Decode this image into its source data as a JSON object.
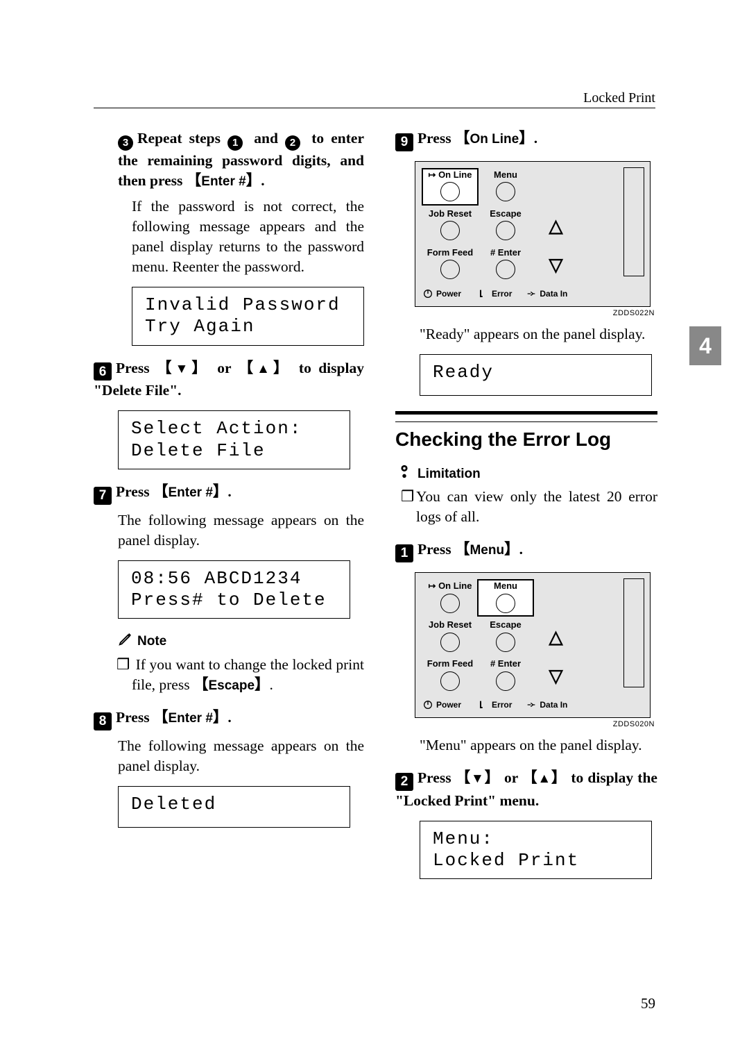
{
  "header": {
    "section": "Locked Print"
  },
  "sidetab": "4",
  "pagenum": "59",
  "left": {
    "sub3": {
      "text_a": "Repeat steps ",
      "text_b": " and ",
      "text_c": " to enter the remaining password digits, and then press ",
      "key": "Enter #",
      "body": "If the password is not correct, the following message appears and the panel display returns to the password menu. Reenter the password.",
      "lcd": "Invalid Password\nTry Again"
    },
    "step6": {
      "lead": "Press ",
      "or": " or ",
      "tail": " to display \"Delete File\".",
      "lcd": "Select Action:\nDelete File"
    },
    "step7": {
      "lead": "Press ",
      "key": "Enter #",
      "body": "The following message appears on the panel display.",
      "lcd": "08:56 ABCD1234\nPress# to Delete"
    },
    "note": {
      "title": "Note",
      "body": "If you want to change the locked print file, press ",
      "key": "Escape"
    },
    "step8": {
      "lead": "Press ",
      "key": "Enter #",
      "body": "The following message appears on the panel display.",
      "lcd": "Deleted"
    }
  },
  "right": {
    "step9": {
      "lead": "Press ",
      "key": "On Line",
      "body": "\"Ready\" appears on the panel display.",
      "lcd": "Ready",
      "caption": "ZDDS022N"
    },
    "section": "Checking the Error Log",
    "limitation": {
      "title": "Limitation",
      "body": "You can view only the latest 20 error logs of all."
    },
    "step1": {
      "lead": "Press ",
      "key": "Menu",
      "body": "\"Menu\" appears on the panel display.",
      "caption": "ZDDS020N"
    },
    "step2": {
      "lead": "Press ",
      "or": " or ",
      "tail": " to display the \"Locked Print\" menu.",
      "lcd": "Menu:\n Locked Print"
    },
    "panel": {
      "online": "On Line",
      "menu": "Menu",
      "jobreset": "Job Reset",
      "escape": "Escape",
      "formfeed": "Form Feed",
      "enter": "Enter",
      "power": "Power",
      "error": "Error",
      "datain": "Data In"
    }
  }
}
